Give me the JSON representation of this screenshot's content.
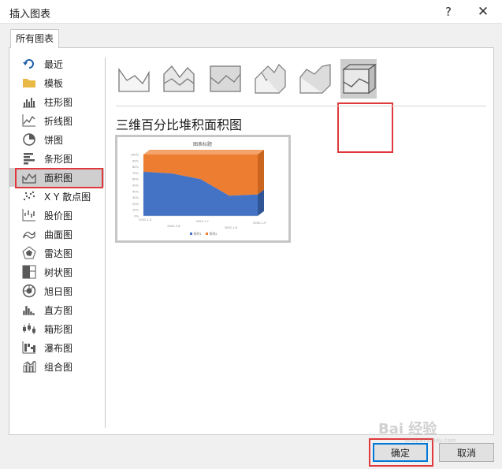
{
  "dialog": {
    "title": "插入图表",
    "help": "?",
    "close": "✕"
  },
  "tab": {
    "label": "所有图表"
  },
  "sidebar": {
    "items": [
      {
        "label": "最近",
        "icon": "recent-icon"
      },
      {
        "label": "模板",
        "icon": "folder-icon"
      },
      {
        "label": "柱形图",
        "icon": "column-chart-icon"
      },
      {
        "label": "折线图",
        "icon": "line-chart-icon"
      },
      {
        "label": "饼图",
        "icon": "pie-chart-icon"
      },
      {
        "label": "条形图",
        "icon": "bar-chart-icon"
      },
      {
        "label": "面积图",
        "icon": "area-chart-icon",
        "selected": true
      },
      {
        "label": "X Y 散点图",
        "icon": "scatter-chart-icon"
      },
      {
        "label": "股价图",
        "icon": "stock-chart-icon"
      },
      {
        "label": "曲面图",
        "icon": "surface-chart-icon"
      },
      {
        "label": "雷达图",
        "icon": "radar-chart-icon"
      },
      {
        "label": "树状图",
        "icon": "treemap-chart-icon"
      },
      {
        "label": "旭日图",
        "icon": "sunburst-chart-icon"
      },
      {
        "label": "直方图",
        "icon": "histogram-chart-icon"
      },
      {
        "label": "箱形图",
        "icon": "box-whisker-chart-icon"
      },
      {
        "label": "瀑布图",
        "icon": "waterfall-chart-icon"
      },
      {
        "label": "组合图",
        "icon": "combo-chart-icon"
      }
    ]
  },
  "subtypes": [
    {
      "icon": "area-icon"
    },
    {
      "icon": "stacked-area-icon"
    },
    {
      "icon": "percent-stacked-area-icon"
    },
    {
      "icon": "3d-area-icon"
    },
    {
      "icon": "3d-stacked-area-icon"
    },
    {
      "icon": "3d-percent-stacked-area-icon",
      "selected": true
    }
  ],
  "selected_chart_name": "三维百分比堆积面积图",
  "preview": {
    "chart_data": {
      "type": "area",
      "stacked": "percent",
      "three_d": true,
      "title": "图表标题",
      "x": [
        "2002-1-5",
        "2002-1-6",
        "2002-1-7",
        "2002-1-8",
        "2002-1-9"
      ],
      "series": [
        {
          "name": "系列1",
          "values": [
            72,
            69,
            60,
            33,
            35
          ],
          "color": "#4472c4"
        },
        {
          "name": "系列2",
          "values": [
            28,
            31,
            40,
            67,
            65
          ],
          "color": "#ed7d31"
        }
      ],
      "y_ticks": [
        "100%",
        "90%",
        "80%",
        "70%",
        "60%",
        "50%",
        "40%",
        "30%",
        "20%",
        "10%",
        "0%"
      ],
      "ylim": [
        0,
        100
      ],
      "legend": "bottom"
    }
  },
  "buttons": {
    "ok": "确定",
    "cancel": "取消"
  },
  "colors": {
    "highlight": "#e0383c",
    "accent": "#0078d7",
    "series1": "#4472c4",
    "series2": "#ed7d31"
  },
  "watermark": {
    "text": "Bai 经验",
    "subtext": "jingyan.baidu.com"
  }
}
